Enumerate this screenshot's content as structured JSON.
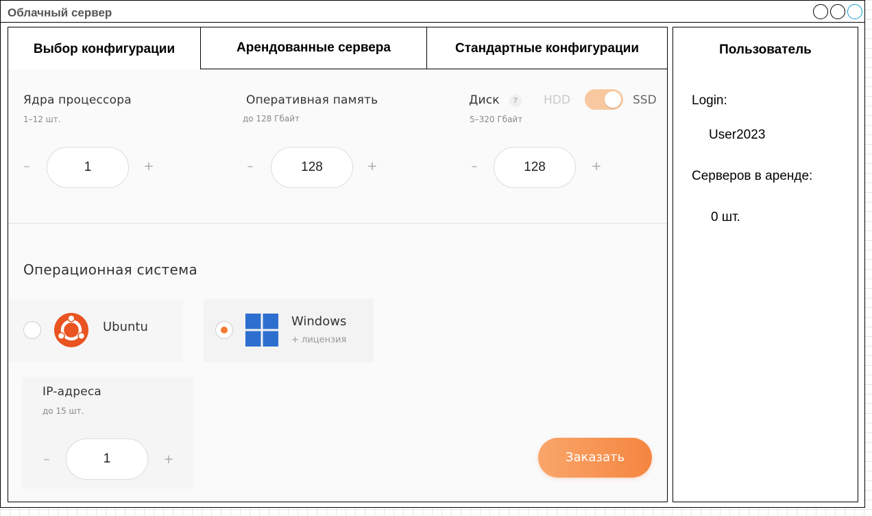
{
  "window": {
    "title": "Облачный сервер"
  },
  "tabs": [
    {
      "label": "Выбор конфигурации",
      "active": true
    },
    {
      "label": "Арендованные сервера",
      "active": false
    },
    {
      "label": "Стандартные конфигурации",
      "active": false
    }
  ],
  "config": {
    "cpu": {
      "label": "Ядра процессора",
      "range": "1–12 шт.",
      "value": "1",
      "minus": "–",
      "plus": "+"
    },
    "ram": {
      "label": "Оперативная память",
      "range": "до 128 Гбайт",
      "value": "128",
      "minus": "–",
      "plus": "+"
    },
    "disk": {
      "label": "Диск",
      "help": "?",
      "range": "5–320 Гбайт",
      "value": "128",
      "minus": "–",
      "plus": "+",
      "option_left": "HDD",
      "option_right": "SSD",
      "selected": "SSD"
    },
    "os_section_title": "Операционная система",
    "os": [
      {
        "name": "Ubuntu",
        "note": "",
        "selected": false,
        "icon": "ubuntu-logo-icon"
      },
      {
        "name": "Windows",
        "note": "+ лицензия",
        "selected": true,
        "icon": "windows-logo-icon"
      }
    ],
    "ip": {
      "label": "IP-адреса",
      "range": "до 15 шт.",
      "value": "1",
      "minus": "–",
      "plus": "+"
    },
    "order_label": "Заказать"
  },
  "user": {
    "title": "Пользователь",
    "login_label": "Login:",
    "login_value": "User2023",
    "servers_label": "Серверов в аренде:",
    "servers_value": "0 шт."
  },
  "colors": {
    "accent": "#f5853f",
    "toggle_on": "#f8c9a0",
    "ubuntu": "#e95420",
    "windows": "#2d6fcf"
  }
}
